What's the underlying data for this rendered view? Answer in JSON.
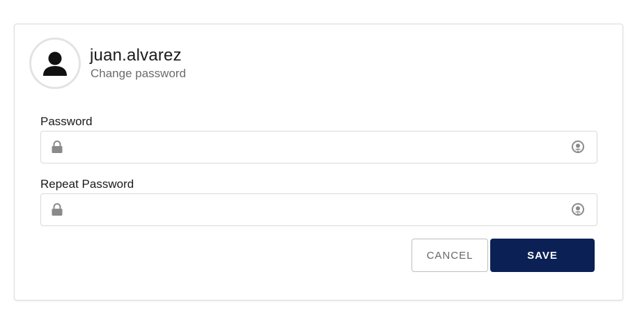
{
  "user": {
    "username": "juan.alvarez",
    "subtitle": "Change password",
    "avatar_icon": "user-silhouette-icon"
  },
  "form": {
    "password": {
      "label": "Password",
      "value": "",
      "placeholder": "",
      "leading_icon": "lock-icon",
      "trailing_icon": "eye-toggle-icon"
    },
    "repeat_password": {
      "label": "Repeat Password",
      "value": "",
      "placeholder": "",
      "leading_icon": "lock-icon",
      "trailing_icon": "eye-toggle-icon"
    }
  },
  "actions": {
    "cancel_label": "CANCEL",
    "save_label": "SAVE"
  },
  "colors": {
    "primary": "#0b2155",
    "icon_gray": "#8a8a8a",
    "border": "#d9d9d9"
  }
}
